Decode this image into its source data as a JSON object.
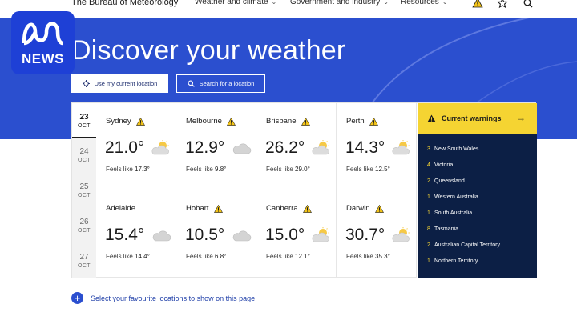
{
  "nav": {
    "site_title": "The Bureau of Meteorology",
    "items": [
      "Weather and climate",
      "Government and industry",
      "Resources"
    ]
  },
  "hero": {
    "title": "Discover your weather",
    "use_location_label": "Use my current location",
    "search_label": "Search for a location"
  },
  "logo": {
    "text": "NEWS"
  },
  "dates": [
    {
      "day": "23",
      "month": "OCT"
    },
    {
      "day": "24",
      "month": "OCT"
    },
    {
      "day": "25",
      "month": "OCT"
    },
    {
      "day": "26",
      "month": "OCT"
    },
    {
      "day": "27",
      "month": "OCT"
    }
  ],
  "cities": [
    {
      "name": "Sydney",
      "temp": "21.0°",
      "feels_prefix": "Feels like",
      "feels": "17.3°",
      "icon": "partly-sunny-icon",
      "warning": true
    },
    {
      "name": "Melbourne",
      "temp": "12.9°",
      "feels_prefix": "Feels like",
      "feels": "9.8°",
      "icon": "cloud-icon",
      "warning": true
    },
    {
      "name": "Brisbane",
      "temp": "26.2°",
      "feels_prefix": "Feels like",
      "feels": "29.0°",
      "icon": "partly-sunny-icon",
      "warning": true
    },
    {
      "name": "Perth",
      "temp": "14.3°",
      "feels_prefix": "Feels like",
      "feels": "12.5°",
      "icon": "partly-sunny-icon",
      "warning": true
    },
    {
      "name": "Adelaide",
      "temp": "15.4°",
      "feels_prefix": "Feels like",
      "feels": "14.4°",
      "icon": "cloud-icon",
      "warning": false
    },
    {
      "name": "Hobart",
      "temp": "10.5°",
      "feels_prefix": "Feels like",
      "feels": "6.8°",
      "icon": "cloud-icon",
      "warning": true
    },
    {
      "name": "Canberra",
      "temp": "15.0°",
      "feels_prefix": "Feels like",
      "feels": "12.1°",
      "icon": "partly-sunny-icon",
      "warning": true
    },
    {
      "name": "Darwin",
      "temp": "30.7°",
      "feels_prefix": "Feels like",
      "feels": "35.3°",
      "icon": "partly-sunny-icon",
      "warning": true
    }
  ],
  "warnings": {
    "title": "Current warnings",
    "items": [
      {
        "count": "3",
        "state": "New South Wales"
      },
      {
        "count": "4",
        "state": "Victoria"
      },
      {
        "count": "2",
        "state": "Queensland"
      },
      {
        "count": "1",
        "state": "Western Australia"
      },
      {
        "count": "1",
        "state": "South Australia"
      },
      {
        "count": "8",
        "state": "Tasmania"
      },
      {
        "count": "2",
        "state": "Australian Capital Territory"
      },
      {
        "count": "1",
        "state": "Northern Territory"
      }
    ]
  },
  "favourites": {
    "label": "Select your favourite locations to show on this page"
  },
  "colors": {
    "brand_blue": "#2b4fcf",
    "warning_yellow": "#f5d432",
    "warnings_bg": "#0c1f45"
  }
}
